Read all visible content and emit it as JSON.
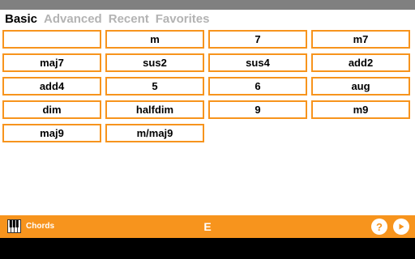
{
  "tabs": [
    {
      "label": "Basic",
      "active": true
    },
    {
      "label": "Advanced",
      "active": false
    },
    {
      "label": "Recent",
      "active": false
    },
    {
      "label": "Favorites",
      "active": false
    }
  ],
  "chords": [
    "",
    "m",
    "7",
    "m7",
    "maj7",
    "sus2",
    "sus4",
    "add2",
    "add4",
    "5",
    "6",
    "aug",
    "dim",
    "halfdim",
    "9",
    "m9",
    "maj9",
    "m/maj9"
  ],
  "bottom_bar": {
    "icon": "piano-keys-icon",
    "title": "Chords",
    "key": "E",
    "help_icon": "help-icon",
    "help_symbol": "?",
    "play_icon": "play-icon"
  },
  "colors": {
    "accent": "#f7941d",
    "status_bar": "#808080",
    "nav_bar": "#000000"
  }
}
